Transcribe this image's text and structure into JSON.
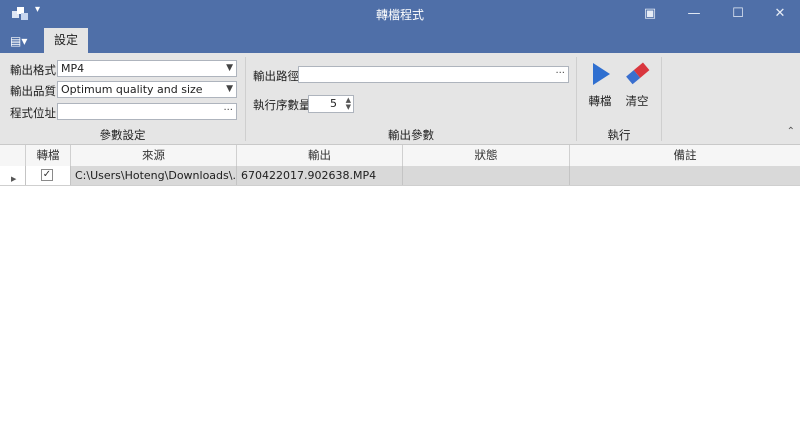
{
  "window": {
    "title": "轉檔程式",
    "menu_arrow": "▾",
    "pin_glyph": "▣",
    "minimize_glyph": "—",
    "maximize_glyph": "☐",
    "close_glyph": "✕"
  },
  "ribbon_tabs": {
    "file_menu_glyph": "▤▾",
    "active_tab": "設定"
  },
  "groups": {
    "params": {
      "caption": "參數設定",
      "format_label": "輸出格式",
      "format_value": "MP4",
      "quality_label": "輸出品質",
      "quality_value": "Optimum quality and size",
      "program_label": "程式位址",
      "program_value": ""
    },
    "output": {
      "caption": "輸出參數",
      "path_label": "輸出路徑",
      "path_value": "",
      "threads_label": "執行序數量",
      "threads_value": "5"
    },
    "execute": {
      "caption": "執行",
      "convert_label": "轉檔",
      "clear_label": "清空"
    }
  },
  "grid": {
    "columns": [
      "轉檔",
      "來源",
      "輸出",
      "狀態",
      "備註"
    ],
    "rows": [
      {
        "selected": true,
        "checked": "✓",
        "source": "C:\\Users\\Hoteng\\Downloads\\...",
        "output": "670422017.902638.MP4",
        "status": "",
        "note": ""
      }
    ]
  },
  "colors": {
    "titlebar": "#4f6fa8",
    "ribbon": "#e5e5e5",
    "play_icon": "#2f6fd0",
    "eraser_icon": "#d9363e"
  }
}
